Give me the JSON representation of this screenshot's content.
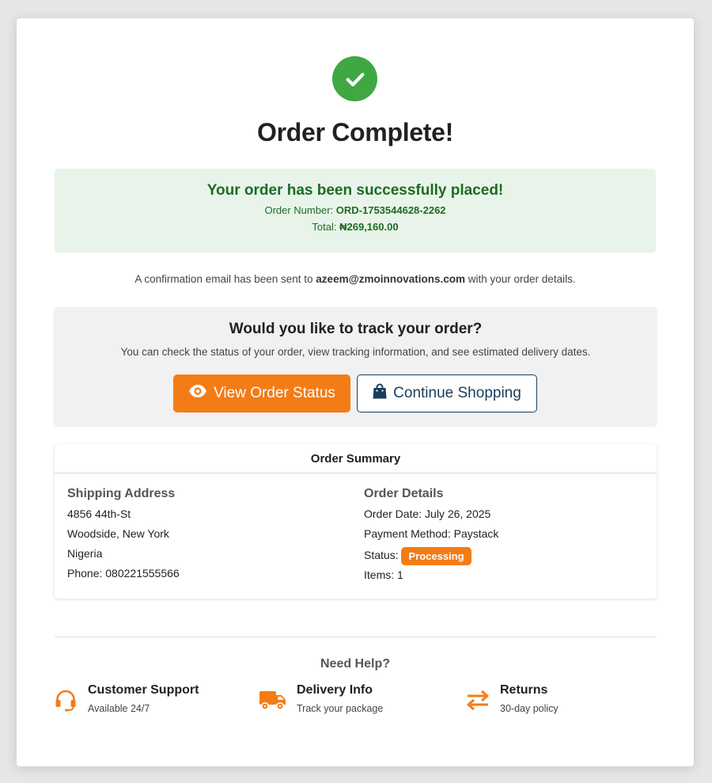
{
  "page_title": "Order Complete!",
  "success": {
    "heading": "Your order has been successfully placed!",
    "order_number_label": "Order Number: ",
    "order_number": "ORD-1753544628-2262",
    "total_label": "Total: ",
    "total": "₦269,160.00"
  },
  "confirmation": {
    "prefix": "A confirmation email has been sent to ",
    "email": "azeem@zmoinnovations.com",
    "suffix": " with your order details."
  },
  "track": {
    "title": "Would you like to track your order?",
    "subtitle": "You can check the status of your order, view tracking information, and see estimated delivery dates.",
    "view_status_label": "View Order Status",
    "continue_label": "Continue Shopping"
  },
  "summary": {
    "title": "Order Summary",
    "shipping": {
      "title": "Shipping Address",
      "lines": [
        "4856 44th-St",
        "Woodside, New York",
        "Nigeria",
        "Phone: 080221555566"
      ]
    },
    "details": {
      "title": "Order Details",
      "order_date": "Order Date: July 26, 2025",
      "payment_method": "Payment Method: Paystack",
      "status_label": "Status: ",
      "status": "Processing",
      "items": "Items: 1"
    }
  },
  "help": {
    "title": "Need Help?",
    "items": [
      {
        "name": "Customer Support",
        "desc": "Available 24/7",
        "icon": "headset-icon"
      },
      {
        "name": "Delivery Info",
        "desc": "Track your package",
        "icon": "truck-icon"
      },
      {
        "name": "Returns",
        "desc": "30-day policy",
        "icon": "exchange-arrows-icon"
      }
    ]
  },
  "colors": {
    "accent": "#f47c16",
    "success": "#3fa842",
    "success_text": "#1e6b25",
    "success_bg": "#e8f4e9",
    "navy": "#1a3d5c"
  }
}
